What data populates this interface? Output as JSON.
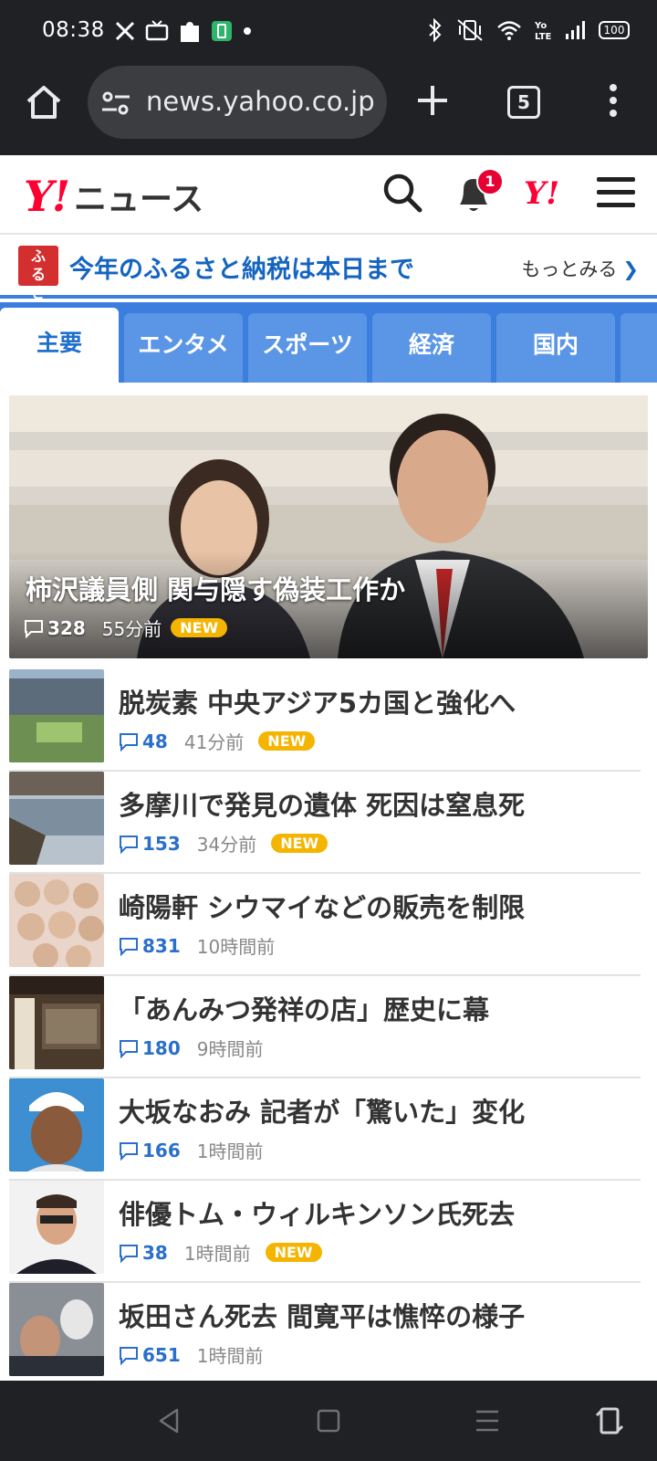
{
  "status_bar": {
    "time": "08:38",
    "battery": "100",
    "left_icons": [
      "x-logo-icon",
      "tv-icon",
      "puzzle-icon",
      "battery-app-icon",
      "dot-icon"
    ],
    "right_icons": [
      "bluetooth-icon",
      "vibrate-off-icon",
      "wifi-icon",
      "volte-icon",
      "signal-icon",
      "battery-icon"
    ]
  },
  "browser": {
    "url": "news.yahoo.co.jp",
    "tab_count": "5"
  },
  "header": {
    "logo_y": "Y!",
    "logo_text": "ニュース",
    "notification_count": "1",
    "yahoo_short": "Y!"
  },
  "promo": {
    "tag": "ふるさと",
    "text": "今年のふるさと納税は本日まで",
    "more": "もっとみる"
  },
  "tabs": [
    {
      "label": "主要",
      "active": true
    },
    {
      "label": "エンタメ",
      "active": false
    },
    {
      "label": "スポーツ",
      "active": false
    },
    {
      "label": "経済",
      "active": false
    },
    {
      "label": "国内",
      "active": false
    }
  ],
  "hero": {
    "title": "柿沢議員側 関与隠す偽装工作か",
    "comments": "328",
    "time": "55分前",
    "new_label": "NEW"
  },
  "articles": [
    {
      "headline": "脱炭素 中央アジア5カ国と強化へ",
      "comments": "48",
      "time": "41分前",
      "new_label": "NEW"
    },
    {
      "headline": "多摩川で発見の遺体 死因は窒息死",
      "comments": "153",
      "time": "34分前",
      "new_label": "NEW"
    },
    {
      "headline": "崎陽軒 シウマイなどの販売を制限",
      "comments": "831",
      "time": "10時間前",
      "new_label": ""
    },
    {
      "headline": "「あんみつ発祥の店」歴史に幕",
      "comments": "180",
      "time": "9時間前",
      "new_label": ""
    },
    {
      "headline": "大坂なおみ 記者が「驚いた」変化",
      "comments": "166",
      "time": "1時間前",
      "new_label": ""
    },
    {
      "headline": "俳優トム・ウィルキンソン氏死去",
      "comments": "38",
      "time": "1時間前",
      "new_label": "NEW"
    },
    {
      "headline": "坂田さん死去 間寛平は憔悴の様子",
      "comments": "651",
      "time": "1時間前",
      "new_label": ""
    }
  ],
  "colors": {
    "yahoo_red": "#ff0033",
    "tab_blue": "#3b7ede",
    "link_blue": "#1565c0",
    "new_badge": "#f4b400",
    "dark_chrome": "#202124"
  }
}
